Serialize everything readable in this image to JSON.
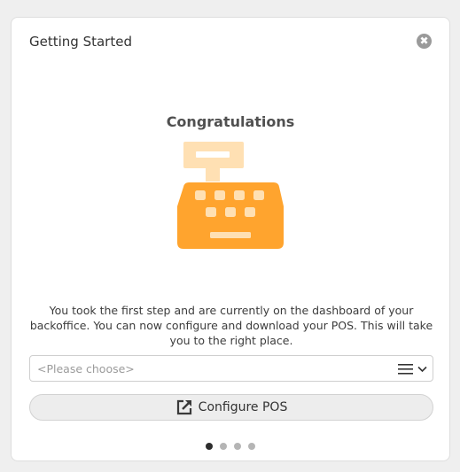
{
  "dialog": {
    "title": "Getting Started",
    "close_symbol": "✖",
    "headline": "Congratulations",
    "illustration_icon": "cash-register-icon",
    "message": "You took the first step and are currently on the dashboard of your backoffice. You can now configure and download your POS. This will take you to the right place.",
    "select": {
      "placeholder": "<Please choose>",
      "icons": [
        "list-icon",
        "chevron-down-icon"
      ]
    },
    "configure_button": {
      "label": "Configure POS",
      "icon": "external-link-icon"
    },
    "pagination": {
      "pages": 4,
      "active_index": 0
    }
  },
  "colors": {
    "accent_orange": "#ffa42e",
    "accent_orange_light": "#ffe0b3",
    "close_bg": "#9a9a9a",
    "dot_active": "#2d2d2d",
    "dot_inactive": "#b5b5b5"
  }
}
